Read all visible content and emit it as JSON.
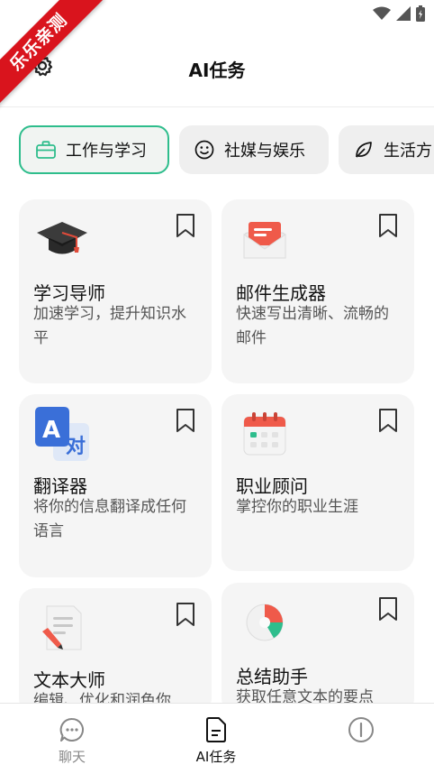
{
  "watermark": "乐乐亲测",
  "header": {
    "title": "AI任务",
    "settings_icon": "gear-icon"
  },
  "tabs": [
    {
      "label": "工作与学习",
      "icon": "briefcase-icon",
      "active": true
    },
    {
      "label": "社媒与娱乐",
      "icon": "smiley-icon",
      "active": false
    },
    {
      "label": "生活方",
      "icon": "leaf-icon",
      "active": false
    }
  ],
  "cards": [
    {
      "title": "学习导师",
      "desc": "加速学习，提升知识水平",
      "icon": "graduation-cap-icon"
    },
    {
      "title": "邮件生成器",
      "desc": "快速写出清晰、流畅的邮件",
      "icon": "envelope-icon"
    },
    {
      "title": "翻译器",
      "desc": "将你的信息翻译成任何语言",
      "icon": "translate-icon"
    },
    {
      "title": "职业顾问",
      "desc": "掌控你的职业生涯",
      "icon": "calendar-icon"
    },
    {
      "title": "文本大师",
      "desc": "编辑、优化和润色你",
      "icon": "document-pen-icon"
    },
    {
      "title": "总结助手",
      "desc": "获取任意文本的要点",
      "icon": "pie-chart-icon"
    }
  ],
  "bottom_nav": {
    "chat": "聊天",
    "ai_tasks": "AI任务",
    "more": ""
  },
  "colors": {
    "accent": "#2ebd8c",
    "watermark": "#d9141d",
    "card_bg": "#f5f5f5",
    "tab_bg": "#efefef"
  }
}
